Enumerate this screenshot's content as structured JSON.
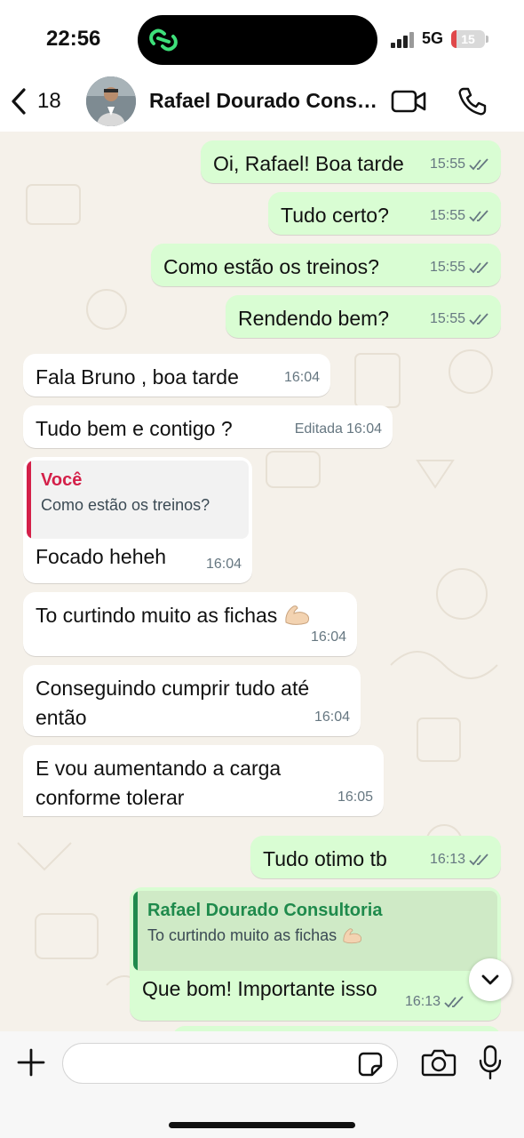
{
  "status_bar": {
    "time": "22:56",
    "network": "5G",
    "battery": "15",
    "battery_level": 0.15
  },
  "header": {
    "back_count": "18",
    "contact_name": "Rafael Dourado Consultoria",
    "icons": [
      "chevron-left-icon",
      "video-call-icon",
      "phone-icon"
    ]
  },
  "messages": [
    {
      "direction": "out",
      "text": "Oi, Rafael! Boa tarde",
      "time": "15:55",
      "status": "read"
    },
    {
      "direction": "out",
      "text": "Tudo certo?",
      "time": "15:55",
      "status": "read"
    },
    {
      "direction": "out",
      "text": "Como estão os treinos?",
      "time": "15:55",
      "status": "read"
    },
    {
      "direction": "out",
      "text": "Rendendo bem?",
      "time": "15:55",
      "status": "read"
    },
    {
      "direction": "in",
      "text": "Fala Bruno , boa tarde",
      "time": "16:04"
    },
    {
      "direction": "in",
      "text": "Tudo bem e contigo ?",
      "edited_label": "Editada",
      "time": "16:04"
    },
    {
      "direction": "in",
      "quote_author": "Você",
      "quote_text": "Como estão os treinos?",
      "text": "Focado heheh",
      "time": "16:04"
    },
    {
      "direction": "in",
      "text": "To curtindo muito as fichas",
      "emoji": "flexed-biceps",
      "time": "16:04"
    },
    {
      "direction": "in",
      "text": "Conseguindo cumprir tudo até então",
      "time": "16:04"
    },
    {
      "direction": "in",
      "text": "E vou aumentando a carga conforme tolerar",
      "time": "16:05"
    },
    {
      "direction": "out",
      "text": "Tudo otimo tb",
      "time": "16:13",
      "status": "read"
    },
    {
      "direction": "out",
      "quote_author": "Rafael Dourado Consultoria",
      "quote_text": "To curtindo muito as fichas",
      "quote_emoji": "flexed-biceps",
      "text": "Que bom! Importante isso",
      "time": "16:13",
      "status": "read"
    }
  ],
  "input": {
    "placeholder": "",
    "icons": [
      "plus-icon",
      "sticker-icon",
      "camera-icon",
      "microphone-icon"
    ]
  },
  "colors": {
    "outgoing_bubble": "#d9fdd3",
    "incoming_bubble": "#ffffff",
    "chat_background": "#f5f1ea",
    "quote_you": "#d42049",
    "quote_contact": "#1f8a4c",
    "read_ticks": "#667781"
  }
}
